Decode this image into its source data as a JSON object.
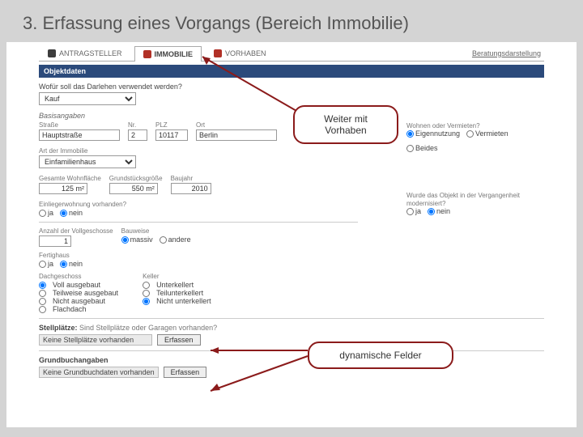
{
  "slide_title": "3. Erfassung eines Vorgangs (Bereich Immobilie)",
  "tabs": {
    "antragsteller": "ANTRAGSTELLER",
    "immobilie": "IMMOBILIE",
    "vorhaben": "VORHABEN",
    "right": "Beratungsdarstellung"
  },
  "section": "Objektdaten",
  "usage_q": "Wofür soll das Darlehen verwendet werden?",
  "usage_sel": "Kauf",
  "basis_hdr": "Basisangaben",
  "addr": {
    "strasse_lbl": "Straße",
    "strasse": "Hauptstraße",
    "nr_lbl": "Nr.",
    "nr": "2",
    "plz_lbl": "PLZ",
    "plz": "10117",
    "ort_lbl": "Ort",
    "ort": "Berlin"
  },
  "right1": {
    "heading": "Wohnen oder Vermieten?",
    "eigen": "Eigennutzung",
    "verm": "Vermieten",
    "beides": "Beides"
  },
  "art_lbl": "Art der Immobilie",
  "art_sel": "Einfamilienhaus",
  "wohn": {
    "wf_lbl": "Gesamte Wohnfläche",
    "wf": "125 m²",
    "gs_lbl": "Grundstücksgröße",
    "gs": "550 m²",
    "bj_lbl": "Baujahr",
    "bj": "2010"
  },
  "right2": {
    "q": "Wurde das Objekt in der Vergangenheit modernisiert?",
    "ja": "ja",
    "nein": "nein"
  },
  "elw": {
    "q": "Einliegerwohnung vorhanden?",
    "ja": "ja",
    "nein": "nein"
  },
  "voll": {
    "lbl": "Anzahl der Vollgeschosse",
    "val": "1"
  },
  "bau": {
    "lbl": "Bauweise",
    "massiv": "massiv",
    "andere": "andere"
  },
  "fertig": {
    "lbl": "Fertighaus",
    "ja": "ja",
    "nein": "nein"
  },
  "dach": {
    "lbl": "Dachgeschoss",
    "v1": "Voll ausgebaut",
    "v2": "Teilweise ausgebaut",
    "v3": "Nicht ausgebaut",
    "v4": "Flachdach"
  },
  "keller": {
    "lbl": "Keller",
    "v1": "Unterkellert",
    "v2": "Teilunterkellert",
    "v3": "Nicht unterkellert"
  },
  "stell": {
    "hdr": "Stellplätze:",
    "q": "Sind Stellplätze oder Garagen vorhanden?",
    "sel": "Keine Stellplätze vorhanden",
    "btn": "Erfassen"
  },
  "grund": {
    "hdr": "Grundbuchangaben",
    "sel": "Keine Grundbuchdaten vorhanden",
    "btn": "Erfassen"
  },
  "callout1a": "Weiter mit",
  "callout1b": "Vorhaben",
  "callout2": "dynamische Felder"
}
